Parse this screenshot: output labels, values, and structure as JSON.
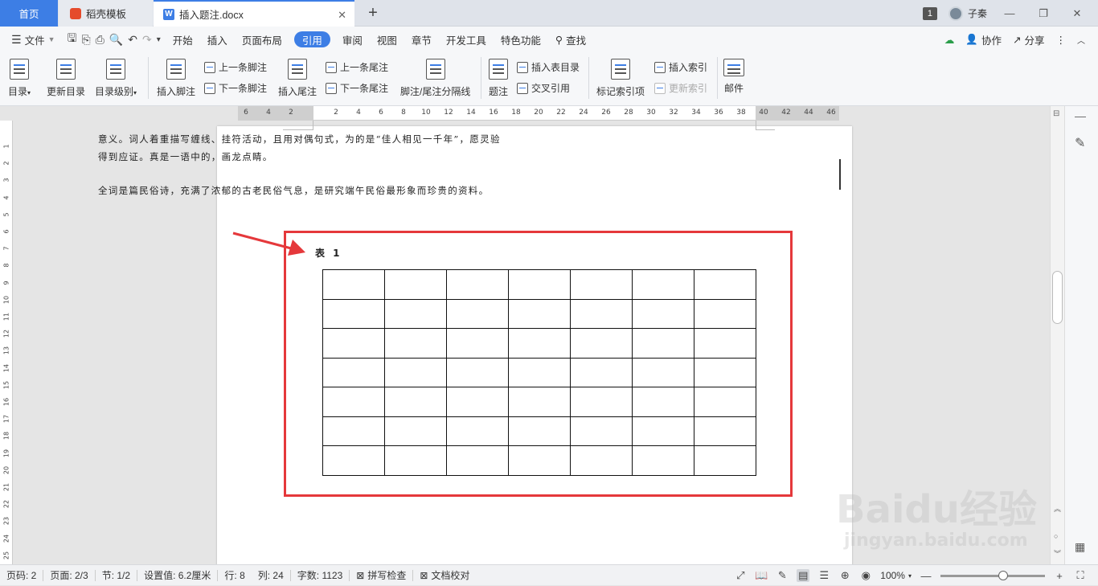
{
  "tabs": {
    "home": "首页",
    "template": "稻壳模板",
    "document": "插入题注.docx",
    "new_tab": "+"
  },
  "titlebar": {
    "badge": "1",
    "user": "子秦"
  },
  "menu": {
    "file": "文件",
    "items": [
      "开始",
      "插入",
      "页面布局",
      "引用",
      "审阅",
      "视图",
      "章节",
      "开发工具",
      "特色功能"
    ],
    "active": "引用",
    "search": "查找",
    "collaborate": "协作",
    "share": "分享"
  },
  "ribbon": {
    "toc": "目录",
    "update_toc": "更新目录",
    "toc_level": "目录级别",
    "insert_footnote": "插入脚注",
    "prev_footnote": "上一条脚注",
    "next_footnote": "下一条脚注",
    "insert_endnote": "插入尾注",
    "prev_endnote": "上一条尾注",
    "next_endnote": "下一条尾注",
    "separator": "脚注/尾注分隔线",
    "caption": "题注",
    "insert_table_toc": "插入表目录",
    "cross_ref": "交叉引用",
    "mark_index": "标记索引项",
    "insert_index": "插入索引",
    "update_index": "更新索引",
    "mail": "邮件"
  },
  "ruler": {
    "h": [
      "6",
      "4",
      "2",
      "",
      "2",
      "4",
      "6",
      "8",
      "10",
      "12",
      "14",
      "16",
      "18",
      "20",
      "22",
      "24",
      "26",
      "28",
      "30",
      "32",
      "34",
      "36",
      "38",
      "40",
      "42",
      "44",
      "46"
    ],
    "v": [
      "1",
      "2",
      "3",
      "4",
      "5",
      "6",
      "7",
      "8",
      "9",
      "10",
      "11",
      "12",
      "13",
      "14",
      "15",
      "16",
      "17",
      "18",
      "19",
      "20",
      "21",
      "22",
      "23",
      "24",
      "25"
    ]
  },
  "document": {
    "line1": "意义。词人着重描写缠线、挂符活动，且用对偶句式，为的是“佳人相见一千年”，愿灵验",
    "line2": "得到应证。真是一语中的，画龙点睛。",
    "line3": "全词是篇民俗诗，充满了浓郁的古老民俗气息，是研究端午民俗最形象而珍贵的资料。",
    "caption": "表 1",
    "table_rows": 7,
    "table_cols": 7
  },
  "status": {
    "page": "页码: 2",
    "pages": "页面: 2/3",
    "section": "节: 1/2",
    "setting": "设置值: 6.2厘米",
    "row": "行: 8",
    "col": "列: 24",
    "words": "字数: 1123",
    "spell": "拼写检查",
    "proof": "文档校对",
    "zoom": "100%"
  },
  "watermark": {
    "brand": "Baidu经验",
    "url": "jingyan.baidu.com"
  },
  "colors": {
    "accent": "#3d7ee5",
    "highlight": "#e5383b"
  }
}
